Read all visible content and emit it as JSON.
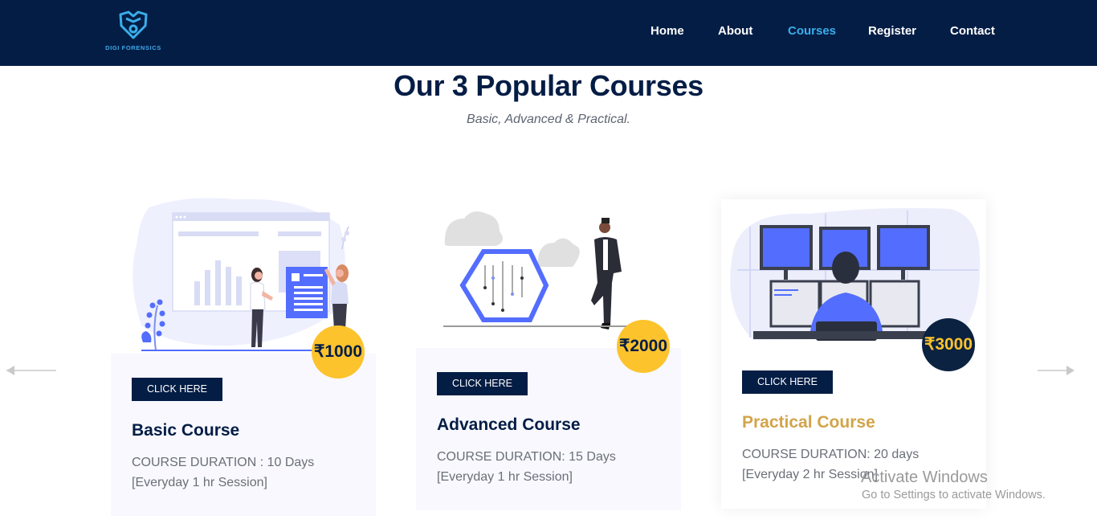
{
  "header": {
    "logo_text": "DIGI FORENSICS",
    "nav": [
      {
        "label": "Home",
        "active": false
      },
      {
        "label": "About",
        "active": false
      },
      {
        "label": "Courses",
        "active": true
      },
      {
        "label": "Register",
        "active": false
      },
      {
        "label": "Contact",
        "active": false
      }
    ]
  },
  "section": {
    "title": "Our 3 Popular Courses",
    "subtitle": "Basic, Advanced & Practical."
  },
  "courses": [
    {
      "price": "₹1000",
      "button": "CLICK HERE",
      "name": "Basic Course",
      "duration": "COURSE DURATION : 10 Days",
      "session": "[Everyday 1 hr Session]",
      "icon": "data-analytics-illustration"
    },
    {
      "price": "₹2000",
      "button": "CLICK HERE",
      "name": "Advanced Course",
      "duration": "COURSE DURATION: 15 Days",
      "session": "[Everyday 1 hr Session]",
      "icon": "circuit-hexagon-illustration"
    },
    {
      "price": "₹3000",
      "button": "CLICK HERE",
      "name": "Practical Course",
      "duration": "COURSE DURATION: 20 days",
      "session": "[Everyday 2 hr Session]",
      "icon": "multi-monitor-illustration"
    }
  ],
  "carousel": {
    "prev_icon": "arrow-left-icon",
    "next_icon": "arrow-right-icon"
  },
  "watermark": {
    "line1": "Activate Windows",
    "line2": "Go to Settings to activate Windows."
  },
  "colors": {
    "navy": "#041d45",
    "nav_active": "#3aaeea",
    "price_badge": "#fdc32d",
    "price_badge_dark": "#0b2240",
    "featured_title": "#d2a44a",
    "accent_blue": "#536dfe"
  }
}
